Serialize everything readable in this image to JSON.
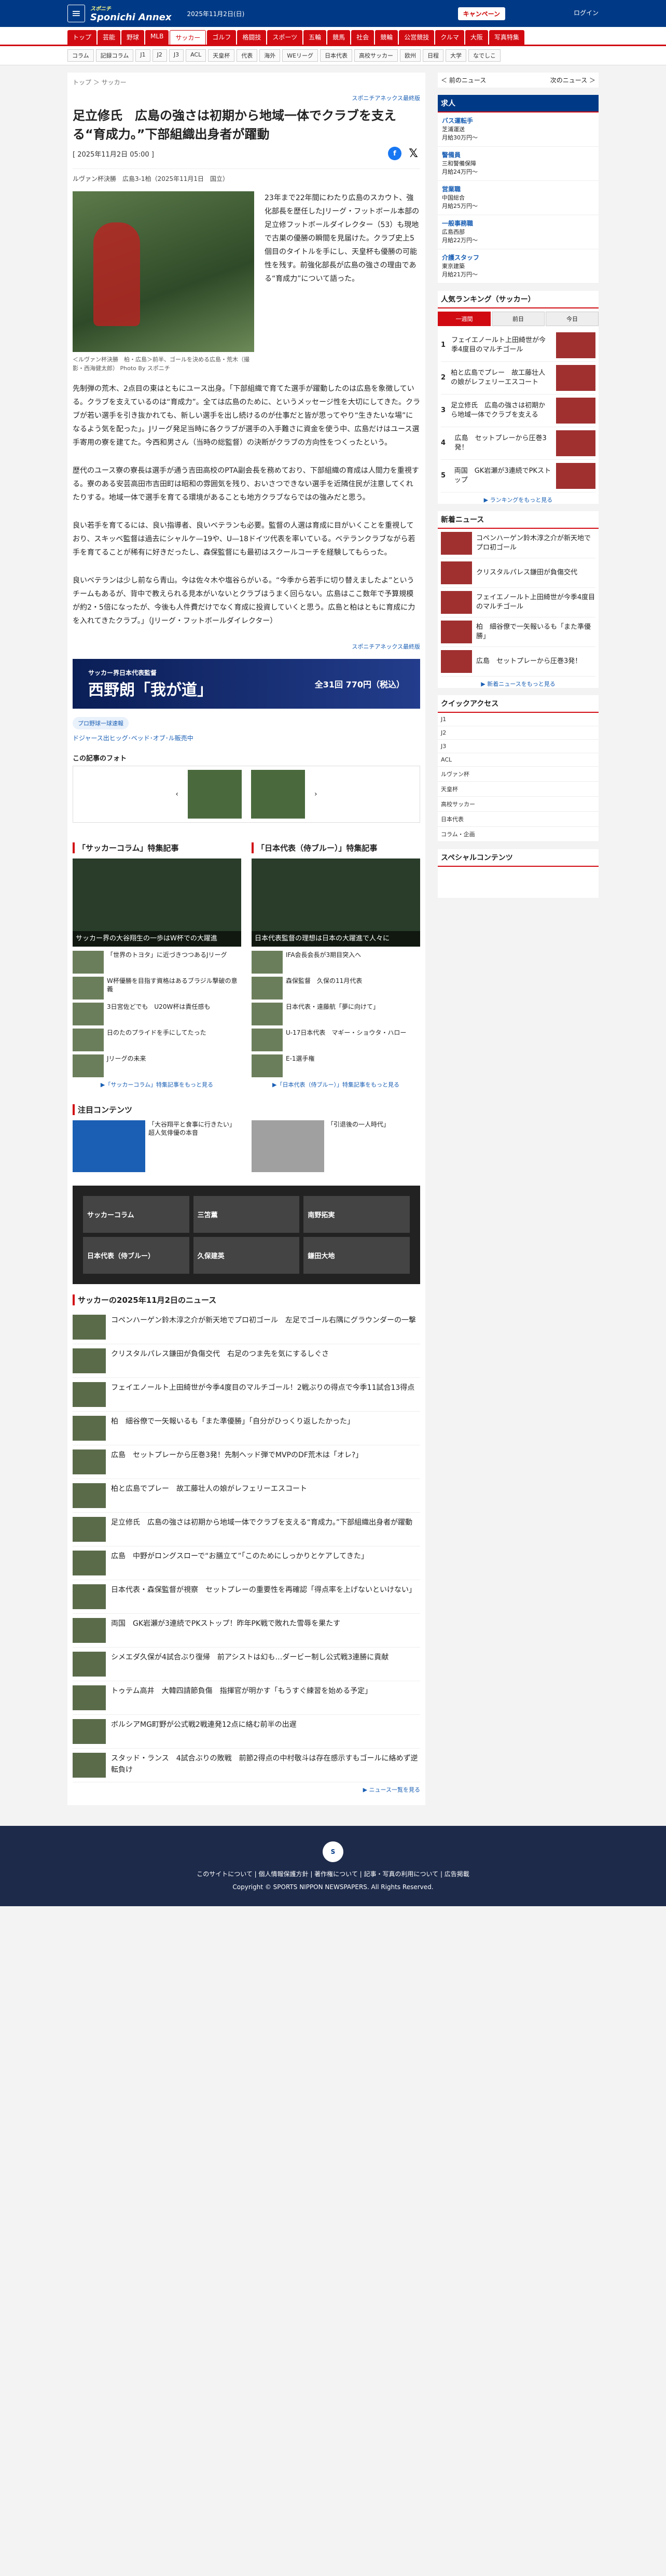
{
  "header": {
    "menu_icon": "menu-icon",
    "logo": "Sponichi Annex",
    "logo_sub": "スポニチ",
    "date": "2025年11月2日(日)",
    "campaign": "キャンペーン",
    "top_right": "ログイン"
  },
  "gnav": [
    "トップ",
    "芸能",
    "野球",
    "MLB",
    "サッカー",
    "ゴルフ",
    "格闘技",
    "スポーツ",
    "五輪",
    "競馬",
    "社会",
    "競輪",
    "公営競技",
    "クルマ",
    "大阪",
    "写真特集"
  ],
  "snav": [
    "コラム",
    "記録コラム",
    "J1",
    "J2",
    "J3",
    "ACL",
    "天皇杯",
    "代表",
    "海外",
    "WEリーグ",
    "日本代表",
    "高校サッカー",
    "欧州",
    "日程",
    "大学",
    "なでしこ"
  ],
  "crumb": "トップ ＞ サッカー",
  "series": "スポニチアネックス最終版",
  "title": "足立修氏　広島の強さは初期から地域一体でクラブを支える“育成力。”下部組織出身者が躍動",
  "pubdate": "[ 2025年11月2日 05:00 ]",
  "meta": "ルヴァン杯決勝　広島3-1柏（2025年11月1日　国立）",
  "caption": "＜ルヴァン杯決勝　柏・広島＞前半、ゴールを決める広島・荒木（撮影・西海健太郎）\nPhoto By スポニチ",
  "paragraphs": [
    "23年まで22年間にわたり広島のスカウト、強化部長を歴任したJリーグ・フットボール本部の足立修フットボールダイレクター（53）も現地で古巣の優勝の瞬間を見届けた。クラブ史上5個目のタイトルを手にし、天皇杯も優勝の可能性を残す。前強化部長が広島の強さの理由である“育成力”について語った。",
    "先制弾の荒木、2点目の東はともにユース出身。「下部組織で育てた選手が躍動したのは広島を象徴している。クラブを支えているのは“育成力”。全ては広島のために、というメッセージ性を大切にしてきた。クラブが若い選手を引き抜かれても、新しい選手を出し続けるのが仕事だと皆が思ってやり“生きたいな場”になるよう気を配った」。Jリーグ発足当時に各クラブが選手の入手難さに資金を使う中、広島だけはユース選手寄用の寮を建てた。今西和男さん（当時の総監督）の決断がクラブの方向性をつくったという。",
    "歴代のユース寮の寮長は選手が通う吉田高校のPTA副会長を務めており、下部組織の育成は人間力を重視する。寮のある安芸高田市吉田町は昭和の雰囲気を残り、おいさつできない選手を近隣住民が注意してくれたりする。地域一体で選手を育てる環境があることも地方クラブならではの強みだと思う。",
    "良い若手を育てるには、良い指導者、良いベテランも必要。監督の人選は育成に目がいくことを重視しており、スキッベ監督は過去にシャルケ—19や、U—18ドイツ代表を率いている。ベテランクラブながら若手を育てることが稀有に好きだったし、森保監督にも最初はスクールコーチを経験してもらった。",
    "良いベテランは少し前なら青山。今は佐々木や塩谷らがいる。“今季から若手に切り替えましたよ”というチームもあるが、背中で教えられる見本がいないとクラブはうまく回らない。広島はここ数年で予算規模が約2・5倍になったが、今後も人件費だけでなく育成に投資していくと思う。広島と柏はともに育成に力を入れてきたクラブ。」（Jリーグ・フットボールダイレクター）"
  ],
  "series_bottom": "スポニチアネックス最終版",
  "banner_text": "西野朗「我が道」",
  "banner_sub": "サッカー界日本代表監督",
  "banner_price": "全31回 770円（税込）",
  "tag": "プロ野球一球速報",
  "rel_link": "ドジャース出ヒッグ･ベッド･オブ･ル販売中",
  "strip_title": "この記事のフォト",
  "col1_title": "「サッカーコラム」特集記事",
  "col2_title": "「日本代表（侍ブルー）」特集記事",
  "col1_feat": "サッカー界の大谷翔生の一歩はW杯での大躍進",
  "col2_feat": "日本代表監督の理想は日本の大躍進で人々に",
  "col1_items": [
    "「世界のトヨタ」に近づきつつあるJリーグ",
    "W杯優勝を目指す資格はあるブラジル撃破の意義",
    "3日宮佐どでも　U20W杯は責任感も",
    "日のたのプライドを手にしてたった",
    "Jリーグの未来"
  ],
  "col2_items": [
    "IFA会長会長が3期目突入へ",
    "森保監督　久保の11月代表",
    "日本代表・遠藤航「夢に向けて」",
    "U-17日本代表　マギー・ショウタ・ハロー",
    "E-1選手権"
  ],
  "col1_more": "▶「サッカーコラム」特集記事をもっと見る",
  "col2_more": "▶「日本代表（侍ブルー）」特集記事をもっと見る",
  "attention_title": "注目コンテンツ",
  "attention": [
    "「大谷翔平と食事に行きたい」超人気俳優の本音",
    "「引退後の一人時代」"
  ],
  "hub": [
    "サッカーコラム",
    "三笘薫",
    "南野拓実",
    "日本代表（侍ブルー）",
    "久保建英",
    "鎌田大地"
  ],
  "list_title": "サッカーの2025年11月2日のニュース",
  "news": [
    "コペンハーゲン鈴木淳之介が新天地でプロ初ゴール　左足でゴール右隅にグラウンダーの一撃",
    "クリスタルパレス鎌田が負傷交代　右足のつま先を気にするしぐさ",
    "フェイエノールト上田綺世が今季4度目のマルチゴール！2戦ぶりの得点で今季11試合13得点",
    "柏　細谷僚で一矢報いるも「また準優勝」「自分がひっくり返したかった」",
    "広島　セットプレーから圧巻3発！先制ヘッド弾でMVPのDF荒木は「オレ?」",
    "柏と広島でプレー　故工藤壮人の娘がレフェリーエスコート",
    "足立修氏　広島の強さは初期から地域一体でクラブを支える“育成力。”下部組織出身者が躍動",
    "広島　中野がロングスローで“お膳立て”「このためにしっかりとケアしてきた」",
    "日本代表・森保監督が視察　セットプレーの重要性を再確認「得点率を上げないといけない」",
    "両国　GK岩瀬が3連続でPKストップ！昨年PK戦で敗れた雪辱を果たす",
    "シメエダ久保が4試合ぶり復帰　前アシストは幻も…ダービー制し公式戦3連勝に貢献",
    "トゥテム高井　大韓四請節負傷　指揮官が明かす「もうすぐ練習を始める予定」",
    "ボルシアMG町野が公式戦2戦連発12点に絡む前半の出遅",
    "スタッド・ランス　4試合ぶりの敗戦　前節2得点の中村敬斗は存在感示すもゴールに絡めず逆転負け"
  ],
  "news_more": "▶ ニュース一覧を見る",
  "side": {
    "prev": "＜ 前のニュース",
    "next": "次のニュース ＞",
    "jobs_title": "求人",
    "jobs": [
      [
        "バス運転手",
        "芝浦運送",
        "月給30万円〜"
      ],
      [
        "警備員",
        "三和警備保障",
        "月給24万円〜"
      ],
      [
        "営業職",
        "中国総合",
        "月給25万円〜"
      ],
      [
        "一般事務職",
        "広島西部",
        "月給22万円〜"
      ],
      [
        "介護スタッフ",
        "東京建築",
        "月給21万円〜"
      ]
    ],
    "rank_title": "人気ランキング（サッカー）",
    "rank_tabs": [
      "一週間",
      "前日",
      "今日"
    ],
    "rank": [
      "フェイエノールト上田綺世が今季4度目のマルチゴール",
      "柏と広島でプレー　故工藤壮人の娘がレフェリーエスコート",
      "足立修氏　広島の強さは初期から地域一体でクラブを支える",
      "広島　セットプレーから圧巻3発！",
      "両国　GK岩瀬が3連続でPKストップ"
    ],
    "rank_more": "▶ ランキングをもっと見る",
    "news_title": "新着ニュース",
    "news": [
      "コペンハーゲン鈴木淳之介が新天地でプロ初ゴール",
      "クリスタルパレス鎌田が負傷交代",
      "フェイエノールト上田綺世が今季4度目のマルチゴール",
      "柏　細谷僚で一矢報いるも「また準優勝」",
      "広島　セットプレーから圧巻3発！"
    ],
    "news_more": "▶ 新着ニュースをもっと見る",
    "quick_title": "クイックアクセス",
    "quick": [
      "J1",
      "J2",
      "J3",
      "ACL",
      "ルヴァン杯",
      "天皇杯",
      "高校サッカー",
      "日本代表",
      "コラム・企画"
    ],
    "special_title": "スペシャルコンテンツ"
  },
  "footer": {
    "links": "このサイトについて | 個人情報保護方針 | 著作権について | 記事・写真の利用について | 広告掲載",
    "copyright": "Copyright © SPORTS NIPPON NEWSPAPERS. All Rights Reserved."
  },
  "colors": {
    "brand": "#003a86",
    "accent": "#d10a11"
  }
}
